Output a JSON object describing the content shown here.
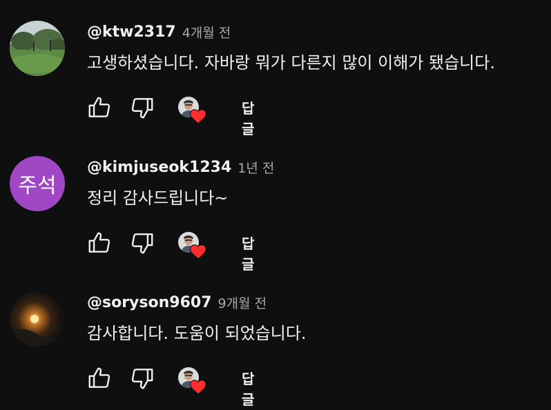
{
  "comments": [
    {
      "username": "@ktw2317",
      "time": "4개월 전",
      "text": "고생하셨습니다. 자바랑 뭐가 다른지 많이 이해가 됐습니다.",
      "avatar_type": "photo-park",
      "reply_label": "답글",
      "like_icon": "thumbs-up-icon",
      "dislike_icon": "thumbs-down-icon",
      "heart_icon": "creator-heart-icon"
    },
    {
      "username": "@kimjuseok1234",
      "time": "1년 전",
      "text": "정리 감사드립니다~",
      "avatar_letter": "주석",
      "avatar_color": "#a047c6",
      "reply_label": "답글",
      "like_icon": "thumbs-up-icon",
      "dislike_icon": "thumbs-down-icon",
      "heart_icon": "creator-heart-icon"
    },
    {
      "username": "@soryson9607",
      "time": "9개월 전",
      "text": "감사합니다. 도움이 되었습니다.",
      "avatar_type": "photo-lamp",
      "reply_label": "답글",
      "like_icon": "thumbs-up-icon",
      "dislike_icon": "thumbs-down-icon",
      "heart_icon": "creator-heart-icon"
    }
  ],
  "colors": {
    "background": "#0f0f0f",
    "text_primary": "#f1f1f1",
    "text_secondary": "#aaaaaa",
    "heart": "#ff2d2d"
  }
}
